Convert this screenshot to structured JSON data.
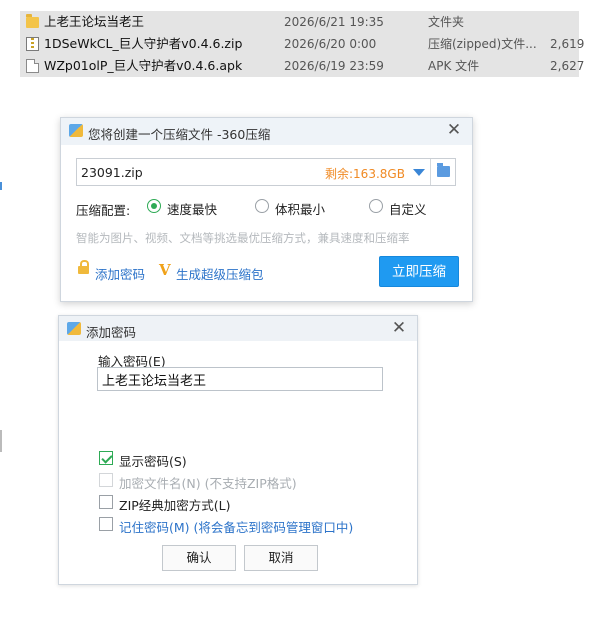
{
  "file_list": {
    "rows": [
      {
        "icon": "folder-icon",
        "name": "上老王论坛当老王",
        "date": "2026/6/21 19:35",
        "type": "文件夹",
        "size": ""
      },
      {
        "icon": "zip-file-icon",
        "name": "1DSeWkCL_巨人守护者v0.4.6.zip",
        "date": "2026/6/20 0:00",
        "type": "压缩(zipped)文件...",
        "size": "2,619"
      },
      {
        "icon": "apk-file-icon",
        "name": "WZp01olP_巨人守护者v0.4.6.apk",
        "date": "2026/6/19 23:59",
        "type": "APK 文件",
        "size": "2,627"
      }
    ]
  },
  "compress_dialog": {
    "title": "您将创建一个压缩文件 -360压缩",
    "filename": "23091.zip",
    "free_space": "剩余:163.8GB",
    "config_label": "压缩配置:",
    "options": [
      "速度最快",
      "体积最小",
      "自定义"
    ],
    "selected_option": "速度最快",
    "hint": "智能为图片、视频、文档等挑选最优压缩方式，兼具速度和压缩率",
    "add_password": "添加密码",
    "super_package": "生成超级压缩包",
    "compress_now": "立即压缩"
  },
  "password_dialog": {
    "title": "添加密码",
    "input_label": "输入密码(E)",
    "password_value": "上老王论坛当老王",
    "options": [
      {
        "label": "显示密码(S)",
        "checked": true,
        "enabled": true
      },
      {
        "label": "加密文件名(N) (不支持ZIP格式)",
        "checked": false,
        "enabled": false
      },
      {
        "label": "ZIP经典加密方式(L)",
        "checked": false,
        "enabled": true
      },
      {
        "label": "记住密码(M) (将会备忘到密码管理窗口中)",
        "checked": false,
        "enabled": true
      }
    ],
    "ok": "确认",
    "cancel": "取消"
  },
  "colors": {
    "accent_blue": "#1f9af1",
    "link_blue": "#2c73c9",
    "check_green": "#2eaa55",
    "free_space_orange": "#f08a24"
  }
}
